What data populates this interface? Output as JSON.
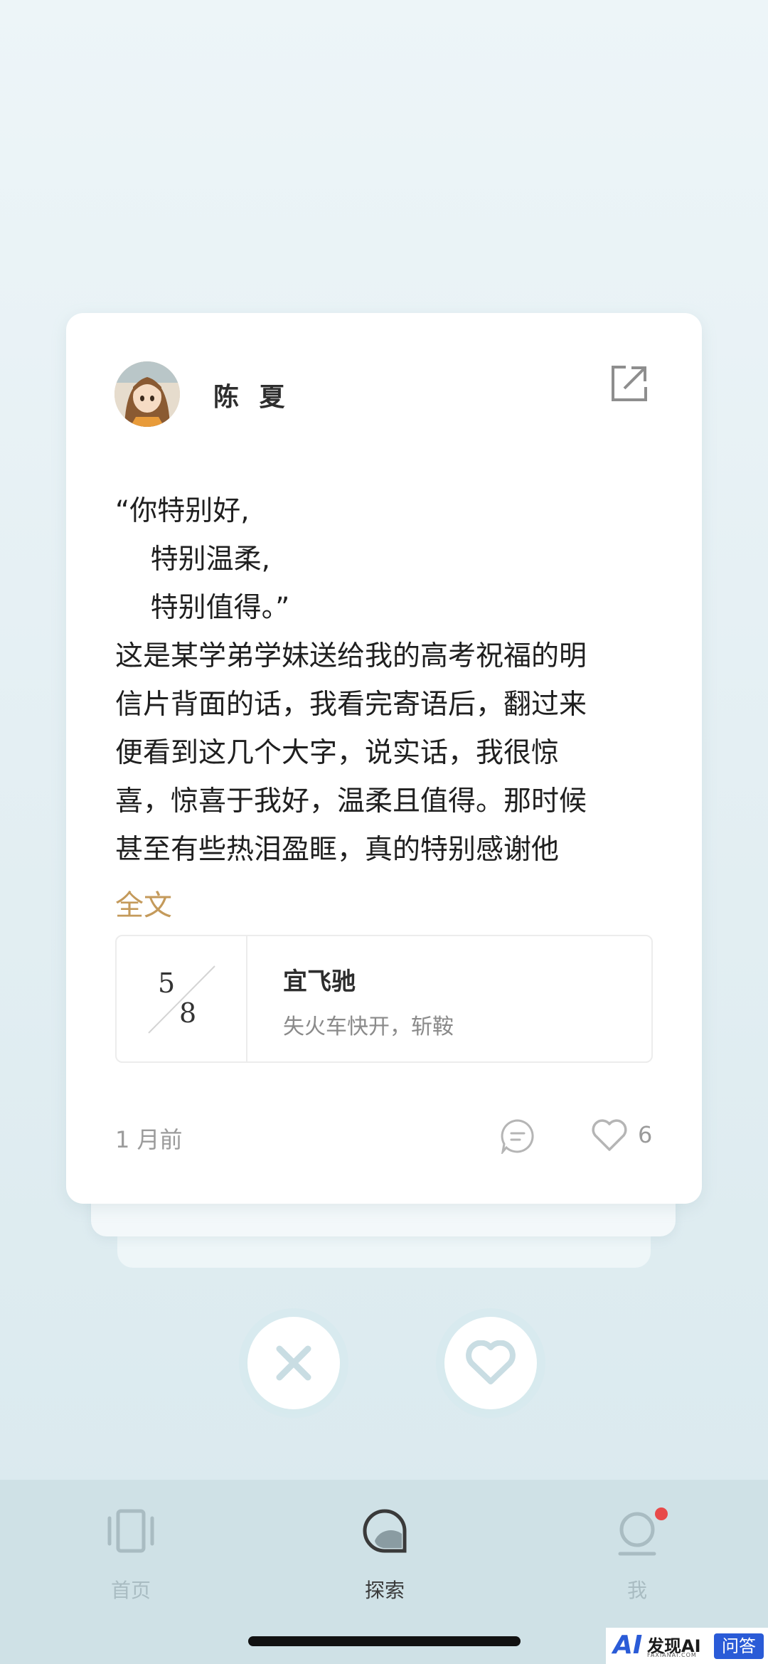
{
  "post": {
    "author": "陈 夏",
    "content_lines": [
      "“你特别好,",
      "    特别温柔,",
      "    特别值得。”",
      "这是某学弟学妹送给我的高考祝福的明",
      "信片背面的话，我看完寄语后，翻过来",
      "便看到这几个大字，说实话，我很惊",
      "喜，惊喜于我好，温柔且值得。那时候",
      "甚至有些热泪盈眶，真的特别感谢他"
    ],
    "full_text_link": "全文",
    "music": {
      "cover_numerator": "5",
      "cover_denominator": "8",
      "title": "宜飞驰",
      "subtitle": "失火车快开，斩鞍"
    },
    "time_ago": "1 月前",
    "like_count": "6"
  },
  "tabs": [
    {
      "label": "首页",
      "active": false
    },
    {
      "label": "探索",
      "active": true
    },
    {
      "label": "我",
      "active": false,
      "badge": true
    }
  ],
  "watermark": {
    "ai": "AI",
    "text": "发现AI",
    "sub": "FAXIANAI.COM",
    "box": "问答"
  },
  "colors": {
    "accent_gold": "#c49a5b",
    "tab_active": "#3a3a3a",
    "tab_inactive": "#a9bcc2",
    "badge_red": "#e84a4a",
    "action_icon": "#c9dde3"
  }
}
